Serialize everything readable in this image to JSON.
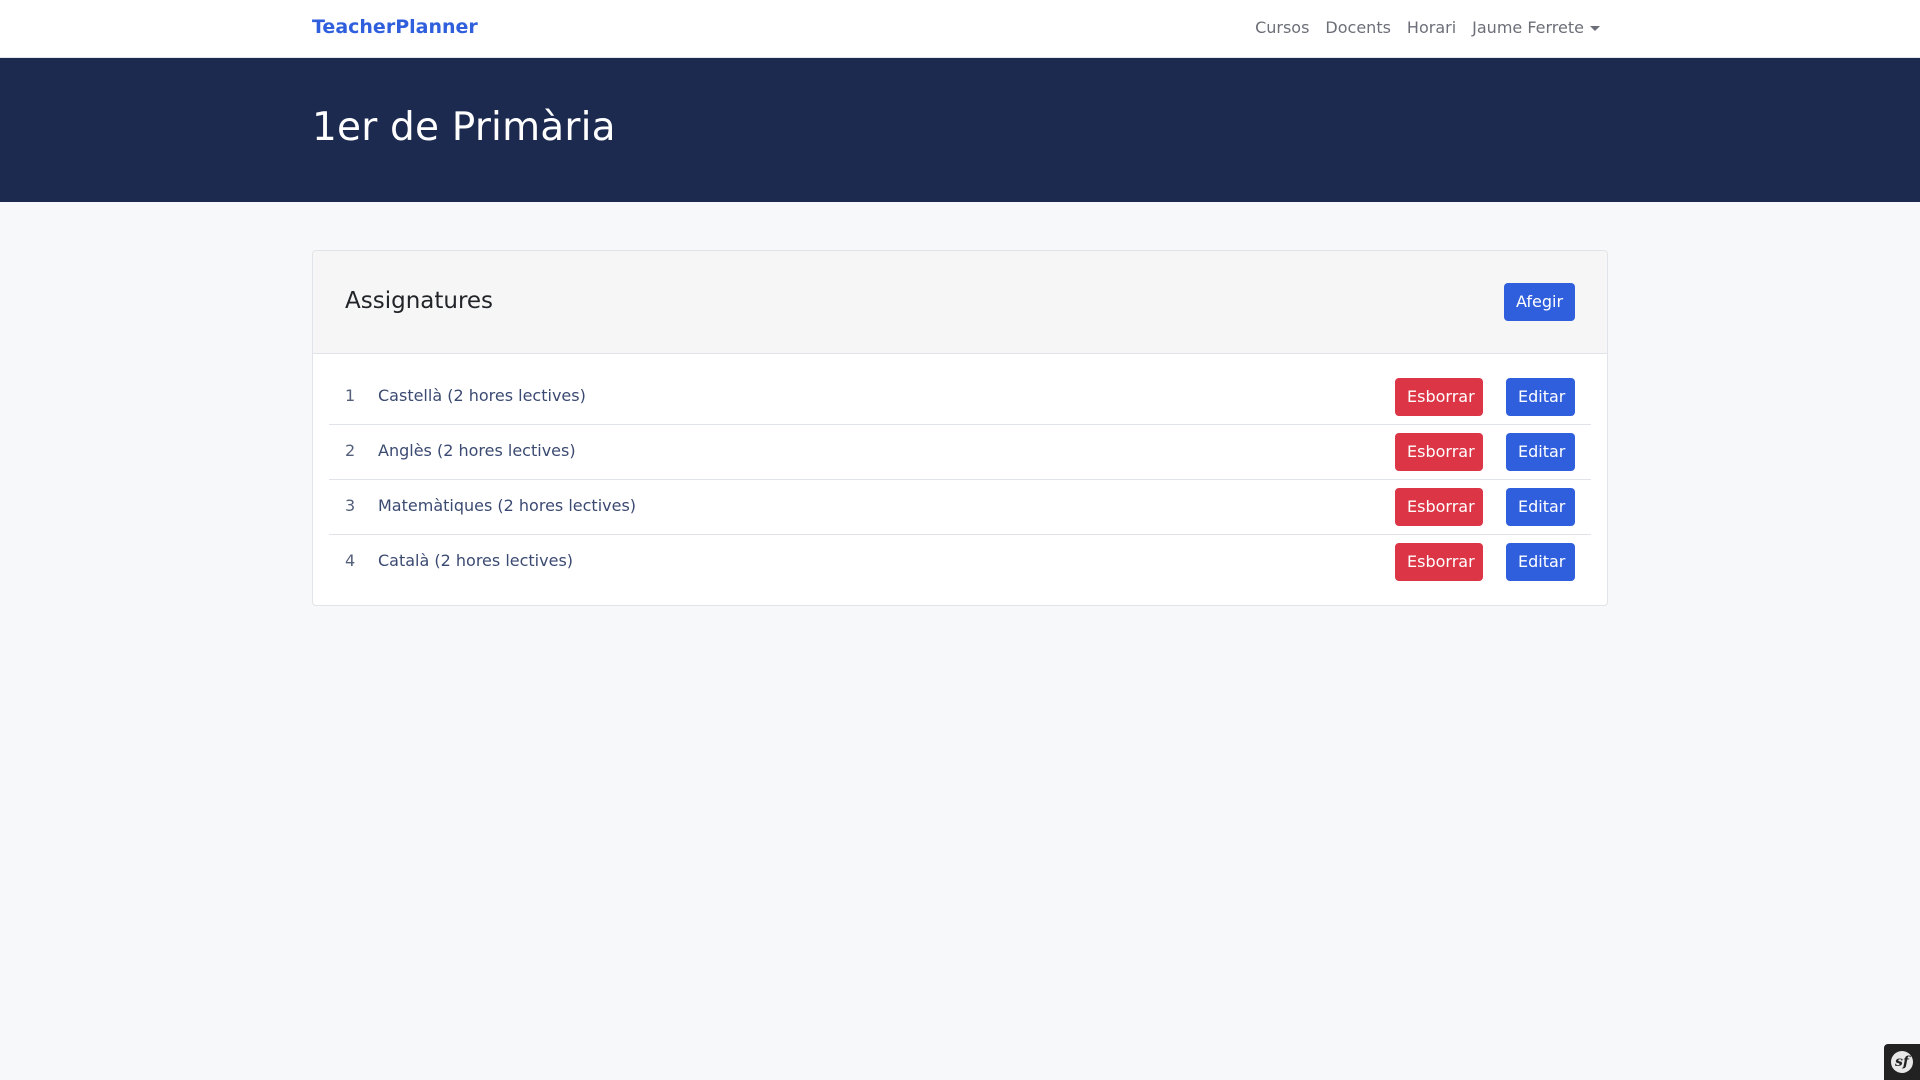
{
  "navbar": {
    "brand": "TeacherPlanner",
    "links": [
      "Cursos",
      "Docents",
      "Horari"
    ],
    "user": "Jaume Ferrete"
  },
  "hero": {
    "title": "1er de Primària"
  },
  "card": {
    "title": "Assignatures",
    "add_label": "Afegir",
    "rows": [
      {
        "num": "1",
        "label": "Castellà (2 hores lectives)",
        "delete": "Esborrar",
        "edit": "Editar"
      },
      {
        "num": "2",
        "label": "Anglès (2 hores lectives)",
        "delete": "Esborrar",
        "edit": "Editar"
      },
      {
        "num": "3",
        "label": "Matemàtiques (2 hores lectives)",
        "delete": "Esborrar",
        "edit": "Editar"
      },
      {
        "num": "4",
        "label": "Català (2 hores lectives)",
        "delete": "Esborrar",
        "edit": "Editar"
      }
    ]
  },
  "colors": {
    "primary": "#2f5fdc",
    "danger": "#dc3545",
    "hero_bg": "#1c2a50",
    "page_bg": "#f7f8fa"
  },
  "icons": {
    "debug_toolbar": "symfony-logo-icon",
    "dropdown": "chevron-down-icon"
  }
}
